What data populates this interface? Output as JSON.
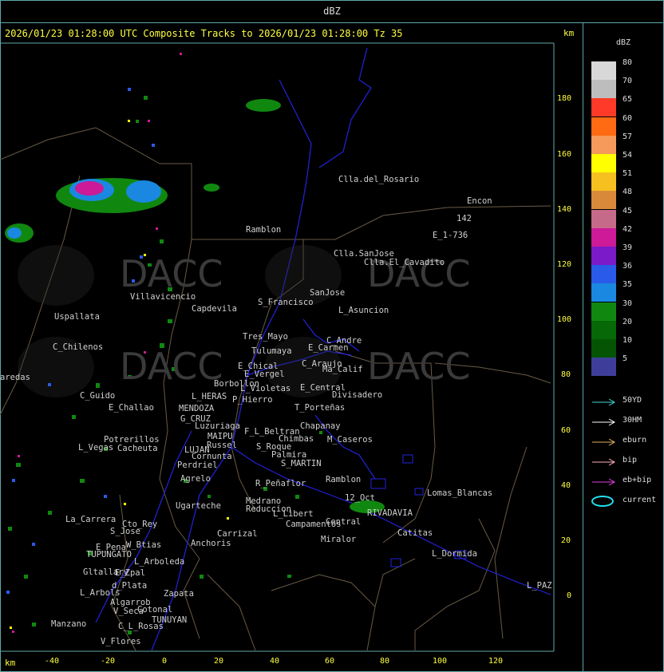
{
  "title": "dBZ",
  "header": "2026/01/23 01:28:00 UTC Composite Tracks to 2026/01/23 01:28:00 Tz 35",
  "units": {
    "km_top": "km",
    "km_bottom": "km"
  },
  "y_ticks": [
    "180",
    "160",
    "140",
    "120",
    "100",
    "80",
    "60",
    "40",
    "20",
    "0"
  ],
  "x_ticks": [
    "-40",
    "-20",
    "0",
    "20",
    "40",
    "60",
    "80",
    "100",
    "120"
  ],
  "places": [
    "Clla.del_Rosario",
    "Encon",
    "142",
    "E_1-736",
    "Ramblon",
    "Clla.SanJose",
    "Clla.El_Cavadito",
    "Villavicencio",
    "Capdevila",
    "S_Francisco",
    "SanJose",
    "L_Asuncion",
    "Uspallata",
    "Tres_Mayo",
    "Tulumaya",
    "C_Andre",
    "E_Carmen",
    "C_Chilenos",
    "E_Chical",
    "C_Araujo",
    "E_Vergel",
    "Ma_Calif",
    "aredas",
    "Borbollon",
    "L_Violetas",
    "E_Central",
    "Divisadero",
    "C_Guido",
    "L_HERAS",
    "P_Hierro",
    "E_Challao",
    "MENDOZA",
    "T_Porteñas",
    "G_CRUZ",
    "Luzuriaga",
    "F_L_Beltran",
    "Chapanay",
    "MAIPU",
    "Russel",
    "Chimbas",
    "M_Caseros",
    "Potrerillos",
    "L_Vegas",
    "Cacheuta",
    "LUJAN",
    "Cornunta",
    "S_Roque",
    "Palmira",
    "Perdriel",
    "S_MARTIN",
    "Agrelo",
    "R_Peñaflor",
    "Ramblon",
    "Ugarteche",
    "Medrano",
    "L_Libert",
    "Reduccion",
    "12_Oct",
    "Lomas_Blancas",
    "La_Carrera",
    "Cto_Rey",
    "S_Jose",
    "Carrizal",
    "Campamentos",
    "Central",
    "RIVADAVIA",
    "Catitas",
    "W_Btias",
    "Anchoris",
    "E_Pena",
    "TUPUNGATO",
    "L_Arboleda",
    "Miralor",
    "L_Dormida",
    "Gltallary",
    "E_Zpal",
    "d_Plata",
    "Zapata",
    "L_PAZ",
    "L_Arbols",
    "Algarrob",
    "V_Seca",
    "Cotonal",
    "TUNUYAN",
    "Manzano",
    "C_L_Rosas",
    "V_Flores"
  ],
  "legend": {
    "title": "dBZ",
    "levels": [
      "80",
      "70",
      "65",
      "60",
      "57",
      "54",
      "51",
      "48",
      "45",
      "42",
      "39",
      "36",
      "35",
      "30",
      "20",
      "10",
      "5"
    ],
    "colors": [
      "#d8d8d8",
      "#bdbdbd",
      "#ff3a28",
      "#ff6a12",
      "#f59a5a",
      "#ffff00",
      "#f5c020",
      "#d88a3a",
      "#c66a8a",
      "#cc1a98",
      "#7a1ac8",
      "#2a5ae8",
      "#1a88e0",
      "#108810",
      "#066806",
      "#045404",
      "#3e3e9a"
    ],
    "tracks": [
      {
        "label": "50YD",
        "color": "#40d8d8"
      },
      {
        "label": "30HM",
        "color": "#ffffff"
      },
      {
        "label": "eburn",
        "color": "#e0b060"
      },
      {
        "label": "bip",
        "color": "#ffb0c0"
      },
      {
        "label": "eb+bip",
        "color": "#e040e0"
      },
      {
        "label": "current",
        "color": "#20e0f0"
      }
    ]
  },
  "watermarks": [
    "DACC",
    "DACC",
    "DACC",
    "DACC"
  ]
}
